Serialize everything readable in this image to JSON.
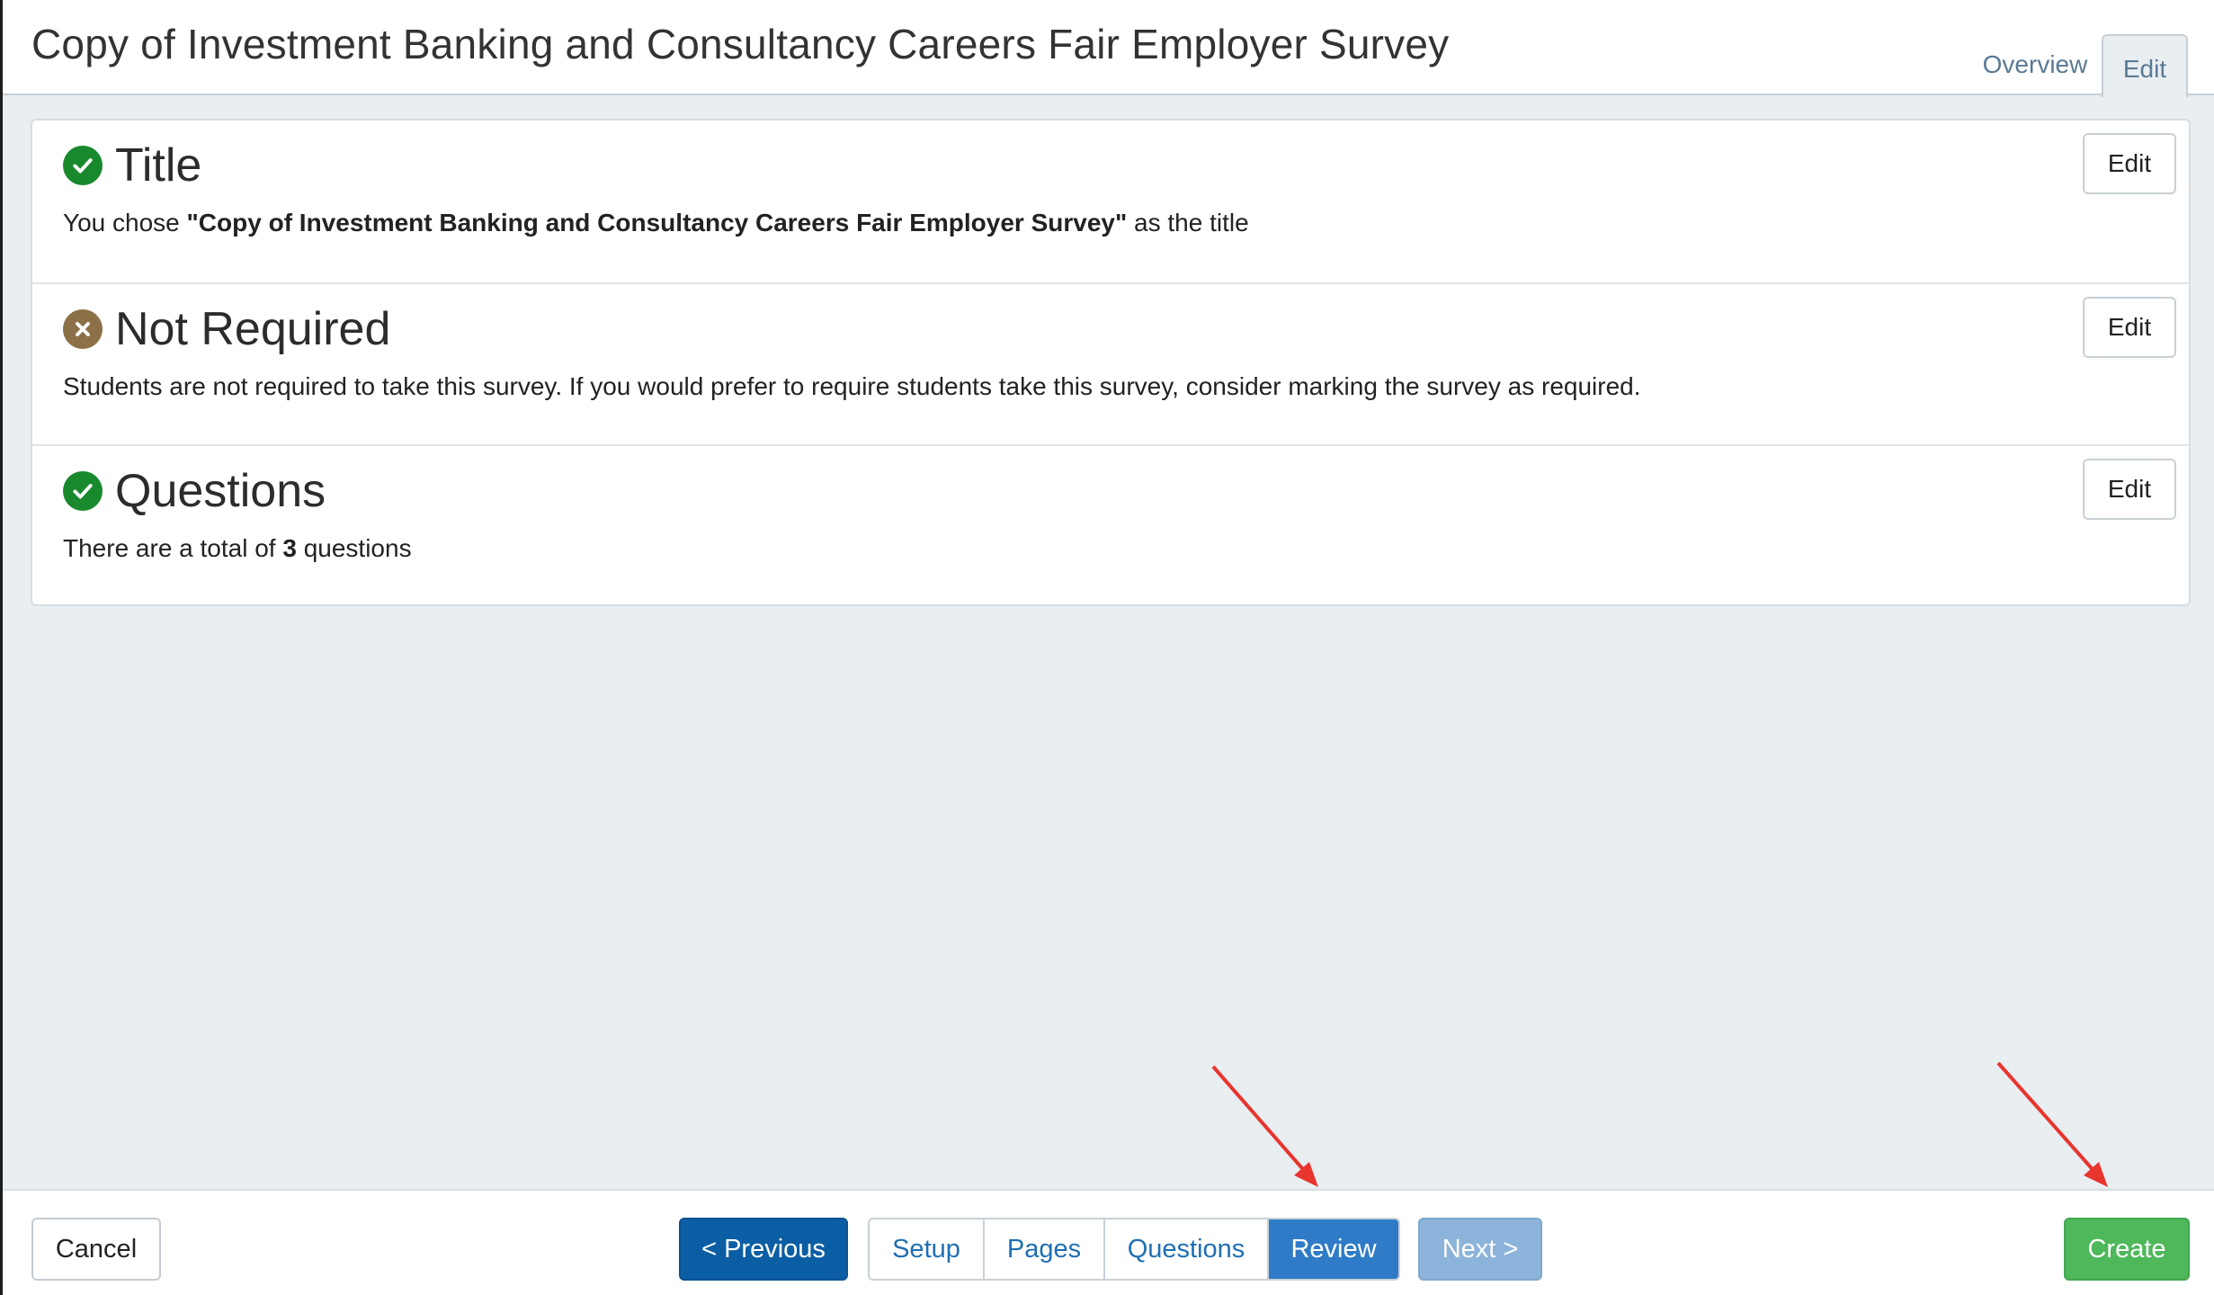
{
  "header": {
    "title": "Copy of Investment Banking and Consultancy Careers Fair Employer Survey",
    "tabs": [
      {
        "label": "Overview",
        "active": false
      },
      {
        "label": "Edit",
        "active": true
      }
    ]
  },
  "review": {
    "sections": [
      {
        "status": "complete",
        "title": "Title",
        "text_pre": "You chose ",
        "text_bold": "\"Copy of Investment Banking and Consultancy Careers Fair Employer Survey\"",
        "text_post": " as the title",
        "edit_label": "Edit"
      },
      {
        "status": "not-required",
        "title": "Not Required",
        "text": "Students are not required to take this survey. If you would prefer to require students take this survey, consider marking the survey as required.",
        "edit_label": "Edit"
      },
      {
        "status": "complete",
        "title": "Questions",
        "text_pre": "There are a total of ",
        "text_bold": "3",
        "text_post": " questions",
        "edit_label": "Edit"
      }
    ]
  },
  "footer": {
    "cancel_label": "Cancel",
    "previous_label": "< Previous",
    "steps": [
      "Setup",
      "Pages",
      "Questions",
      "Review"
    ],
    "active_step": "Review",
    "next_label": "Next >",
    "create_label": "Create"
  },
  "colors": {
    "complete": "#18892d",
    "not_required": "#8c7047",
    "primary": "#0b5ea3",
    "step_active": "#2f7bc7",
    "next_disabled": "#8cb3d9",
    "create": "#4fb85b",
    "annotation_arrow": "#e8352e"
  }
}
